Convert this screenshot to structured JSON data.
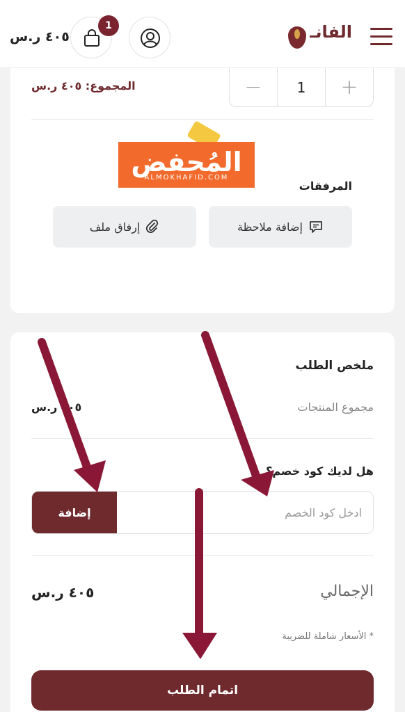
{
  "header": {
    "logo_text": "الفانـ",
    "cart_count": "1",
    "cart_total": "٤٠٥ ر.س"
  },
  "cart_item": {
    "total_text": "المجموع: ٤٠٥ ر.س",
    "quantity": "1",
    "plus": "+",
    "minus": "−"
  },
  "watermark": {
    "brand": "المُحفض",
    "sub": "ALMOKHAFID.COM"
  },
  "attachments": {
    "label": "المرفقات",
    "add_note": "إضافة ملاحظة",
    "attach_file": "إرفاق ملف"
  },
  "summary": {
    "title": "ملخص الطلب",
    "subtotal_label": "مجموع المنتجات",
    "subtotal_value": "٤٠٥ ر.س",
    "coupon_question": "هل لديك كود خصم؟",
    "coupon_placeholder": "ادخل كود الخصم",
    "coupon_button": "إضافة",
    "total_label": "الإجمالي",
    "total_value": "٤٠٥ ر.س",
    "tax_note": "* الأسعار شاملة للضريبة",
    "checkout_button": "اتمام الطلب"
  },
  "colors": {
    "brand": "#6f2a2e",
    "badge": "#7a2430",
    "arrow": "#8a1736"
  }
}
